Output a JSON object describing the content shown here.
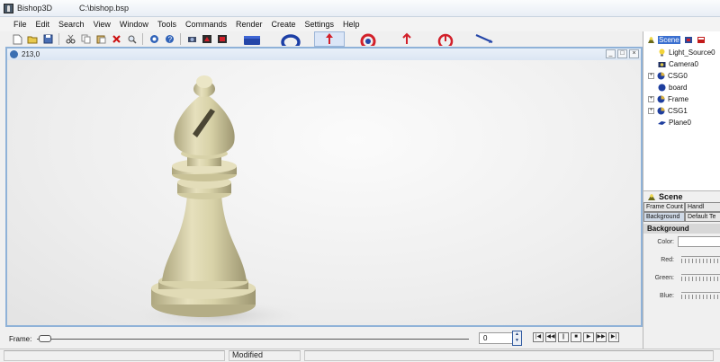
{
  "window": {
    "app_name": "Bishop3D",
    "file_path": "C:\\bishop.bsp"
  },
  "menu": [
    "File",
    "Edit",
    "Search",
    "View",
    "Window",
    "Tools",
    "Commands",
    "Render",
    "Create",
    "Settings",
    "Help"
  ],
  "toolbar": {
    "icons": [
      "new-file-icon",
      "open-icon",
      "save-icon",
      "cut-icon",
      "copy-icon",
      "paste-icon",
      "delete-icon",
      "find-icon",
      "render-icon",
      "help-icon",
      "camera-icon",
      "render-scene-icon",
      "render-region-icon"
    ],
    "tools": [
      "box-tool-icon",
      "torus-tool-icon",
      "move-tool-icon",
      "scale-tool-icon",
      "rotate-arrow-tool-icon",
      "rotate-tool-icon",
      "line-tool-icon"
    ],
    "selected_tool": "move-tool-icon"
  },
  "viewport": {
    "coordinate": "213,0"
  },
  "frame": {
    "label": "Frame:",
    "value": "0",
    "controls": [
      "first-frame-icon",
      "prev-frame-icon",
      "pause-icon",
      "stop-icon",
      "play-icon",
      "next-frame-icon",
      "last-frame-icon"
    ]
  },
  "status": {
    "text": "Modified"
  },
  "scene_tree": {
    "root": "Scene",
    "items": [
      {
        "label": "Light_Source0",
        "icon": "light-bulb-icon",
        "expandable": false
      },
      {
        "label": "Camera0",
        "icon": "camera-icon",
        "expandable": false
      },
      {
        "label": "CSG0",
        "icon": "csg-icon",
        "expandable": true
      },
      {
        "label": "board",
        "icon": "object-icon",
        "expandable": false
      },
      {
        "label": "Frame",
        "icon": "csg-icon",
        "expandable": true
      },
      {
        "label": "CSG1",
        "icon": "csg-icon",
        "expandable": true
      },
      {
        "label": "Plane0",
        "icon": "plane-icon",
        "expandable": false
      }
    ]
  },
  "properties": {
    "title": "Scene",
    "tabs_row1": [
      "Frame Count",
      "Handl"
    ],
    "tabs_row2": [
      "Background",
      "Default Te"
    ],
    "active_tab": "Background",
    "section": "Background",
    "fields": [
      "Color:",
      "Red:",
      "Green:",
      "Blue:"
    ]
  },
  "colors": {
    "accent_blue": "#1f4fa8",
    "tool_red": "#d2202a",
    "viewport_border": "#8fb2d8",
    "chess_piece": "#d8d2a8"
  }
}
